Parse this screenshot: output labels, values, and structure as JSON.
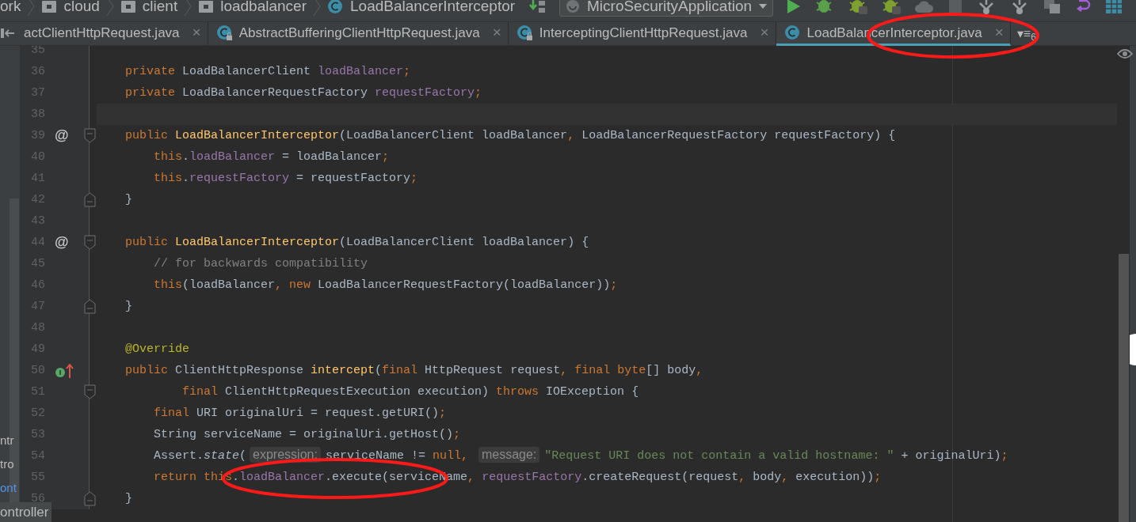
{
  "breadcrumbs": [
    {
      "label": "ork"
    },
    {
      "label": "cloud",
      "kind": "folder"
    },
    {
      "label": "client",
      "kind": "folder"
    },
    {
      "label": "loadbalancer",
      "kind": "folder"
    },
    {
      "label": "LoadBalancerInterceptor",
      "kind": "class"
    }
  ],
  "run_config": {
    "label": "MicroSecurityApplication"
  },
  "tabs": [
    {
      "label": "actClientHttpRequest.java",
      "close": "×",
      "selected": false
    },
    {
      "label": "AbstractBufferingClientHttpRequest.java",
      "kind": "class",
      "locked": true,
      "close": "×",
      "selected": false
    },
    {
      "label": "InterceptingClientHttpRequest.java",
      "kind": "class",
      "locked": true,
      "close": "×",
      "selected": false
    },
    {
      "label": "LoadBalancerInterceptor.java",
      "kind": "class",
      "locked": false,
      "close": "×",
      "selected": true
    }
  ],
  "tab_overflow": {
    "glyph": "▾≡",
    "count": "6"
  },
  "project_panel": {
    "items": [
      {
        "label": "ntr",
        "color": "#bbbbbb"
      },
      {
        "label": "tro",
        "color": "#bbbbbb"
      },
      {
        "label": "ont",
        "color": "#5394ec"
      }
    ],
    "tooltip": "ontroller"
  },
  "editor": {
    "lines": [
      {
        "n": "35",
        "current": false
      },
      {
        "n": "36",
        "current": false,
        "tokens": [
          {
            "kind": "kw",
            "text": "    private "
          },
          {
            "kind": "p",
            "text": "LoadBalancerClient "
          },
          {
            "kind": "fld",
            "text": "loadBalancer"
          },
          {
            "kind": "kw",
            "text": ";"
          }
        ]
      },
      {
        "n": "37",
        "current": false,
        "tokens": [
          {
            "kind": "kw",
            "text": "    private "
          },
          {
            "kind": "p",
            "text": "LoadBalancerRequestFactory "
          },
          {
            "kind": "fld",
            "text": "requestFactory"
          },
          {
            "kind": "kw",
            "text": ";"
          }
        ]
      },
      {
        "n": "38",
        "current": true
      },
      {
        "n": "39",
        "current": false,
        "gutter": [
          {
            "kind": "mark",
            "text": "@"
          },
          {
            "kind": "fold_start"
          }
        ],
        "tokens": [
          {
            "kind": "kw",
            "text": "    public "
          },
          {
            "kind": "decl",
            "text": "LoadBalancerInterceptor"
          },
          {
            "kind": "p",
            "text": "(LoadBalancerClient loadBalancer"
          },
          {
            "kind": "kw",
            "text": ", "
          },
          {
            "kind": "p",
            "text": "LoadBalancerRequestFactory requestFactory) {"
          }
        ]
      },
      {
        "n": "40",
        "current": false,
        "tokens": [
          {
            "kind": "kw",
            "text": "        this"
          },
          {
            "kind": "p",
            "text": "."
          },
          {
            "kind": "fld",
            "text": "loadBalancer"
          },
          {
            "kind": "p",
            "text": " = loadBalancer"
          },
          {
            "kind": "kw",
            "text": ";"
          }
        ]
      },
      {
        "n": "41",
        "current": false,
        "tokens": [
          {
            "kind": "kw",
            "text": "        this"
          },
          {
            "kind": "p",
            "text": "."
          },
          {
            "kind": "fld",
            "text": "requestFactory"
          },
          {
            "kind": "p",
            "text": " = requestFactory"
          },
          {
            "kind": "kw",
            "text": ";"
          }
        ]
      },
      {
        "n": "42",
        "current": false,
        "gutter": [
          {
            "kind": "fold_end"
          }
        ],
        "tokens": [
          {
            "kind": "p",
            "text": "    }"
          }
        ]
      },
      {
        "n": "43",
        "current": false
      },
      {
        "n": "44",
        "current": false,
        "gutter": [
          {
            "kind": "mark",
            "text": "@"
          },
          {
            "kind": "fold_start"
          }
        ],
        "tokens": [
          {
            "kind": "kw",
            "text": "    public "
          },
          {
            "kind": "decl",
            "text": "LoadBalancerInterceptor"
          },
          {
            "kind": "p",
            "text": "(LoadBalancerClient loadBalancer) {"
          }
        ]
      },
      {
        "n": "45",
        "current": false,
        "tokens": [
          {
            "kind": "cm",
            "text": "        // for backwards compatibility"
          }
        ]
      },
      {
        "n": "46",
        "current": false,
        "tokens": [
          {
            "kind": "kw",
            "text": "        this"
          },
          {
            "kind": "p",
            "text": "(loadBalancer"
          },
          {
            "kind": "kw",
            "text": ", new "
          },
          {
            "kind": "p",
            "text": "LoadBalancerRequestFactory(loadBalancer))"
          },
          {
            "kind": "kw",
            "text": ";"
          }
        ]
      },
      {
        "n": "47",
        "current": false,
        "gutter": [
          {
            "kind": "fold_end"
          }
        ],
        "tokens": [
          {
            "kind": "p",
            "text": "    }"
          }
        ]
      },
      {
        "n": "48",
        "current": false
      },
      {
        "n": "49",
        "current": false,
        "tokens": [
          {
            "kind": "ann",
            "text": "    @Override"
          }
        ]
      },
      {
        "n": "50",
        "current": false,
        "gutter": [
          {
            "kind": "implements"
          }
        ],
        "tokens": [
          {
            "kind": "kw",
            "text": "    public "
          },
          {
            "kind": "p",
            "text": "ClientHttpResponse "
          },
          {
            "kind": "decl",
            "text": "intercept"
          },
          {
            "kind": "p",
            "text": "("
          },
          {
            "kind": "kw",
            "text": "final "
          },
          {
            "kind": "p",
            "text": "HttpRequest request"
          },
          {
            "kind": "kw",
            "text": ", final byte"
          },
          {
            "kind": "p",
            "text": "[] body"
          },
          {
            "kind": "kw",
            "text": ","
          }
        ]
      },
      {
        "n": "51",
        "current": false,
        "gutter": [
          {
            "kind": "fold_start"
          }
        ],
        "tokens": [
          {
            "kind": "kw",
            "text": "            final "
          },
          {
            "kind": "p",
            "text": "ClientHttpRequestExecution execution) "
          },
          {
            "kind": "kw",
            "text": "throws "
          },
          {
            "kind": "p",
            "text": "IOException {"
          }
        ]
      },
      {
        "n": "52",
        "current": false,
        "tokens": [
          {
            "kind": "kw",
            "text": "        final "
          },
          {
            "kind": "p",
            "text": "URI originalUri = request.getURI()"
          },
          {
            "kind": "kw",
            "text": ";"
          }
        ]
      },
      {
        "n": "53",
        "current": false,
        "tokens": [
          {
            "kind": "p",
            "text": "        String serviceName = originalUri.getHost()"
          },
          {
            "kind": "kw",
            "text": ";"
          }
        ]
      },
      {
        "n": "54",
        "current": false,
        "tokens": [
          {
            "kind": "p",
            "text": "        Assert."
          },
          {
            "kind": "ital",
            "text": "state"
          },
          {
            "kind": "p",
            "text": "("
          },
          {
            "kind": "hint",
            "text": "expression:"
          },
          {
            "kind": "p",
            "text": "serviceName != "
          },
          {
            "kind": "kw",
            "text": "null, "
          },
          {
            "kind": "hint",
            "text": "message:"
          },
          {
            "kind": "str",
            "text": "\"Request URI does not contain a valid hostname: \""
          },
          {
            "kind": "p",
            "text": " + originalUri)"
          },
          {
            "kind": "kw",
            "text": ";"
          }
        ]
      },
      {
        "n": "55",
        "current": false,
        "tokens": [
          {
            "kind": "kw",
            "text": "        return this"
          },
          {
            "kind": "p",
            "text": "."
          },
          {
            "kind": "fld",
            "text": "loadBalancer"
          },
          {
            "kind": "p",
            "text": ".execute(serviceName"
          },
          {
            "kind": "kw",
            "text": ", "
          },
          {
            "kind": "fld",
            "text": "requestFactory"
          },
          {
            "kind": "p",
            "text": ".createRequest(request"
          },
          {
            "kind": "kw",
            "text": ", "
          },
          {
            "kind": "p",
            "text": "body"
          },
          {
            "kind": "kw",
            "text": ", "
          },
          {
            "kind": "p",
            "text": "execution))"
          },
          {
            "kind": "kw",
            "text": ";"
          }
        ]
      },
      {
        "n": "56",
        "current": false,
        "gutter": [
          {
            "kind": "fold_end"
          }
        ],
        "tokens": [
          {
            "kind": "p",
            "text": "    }"
          }
        ]
      }
    ]
  }
}
